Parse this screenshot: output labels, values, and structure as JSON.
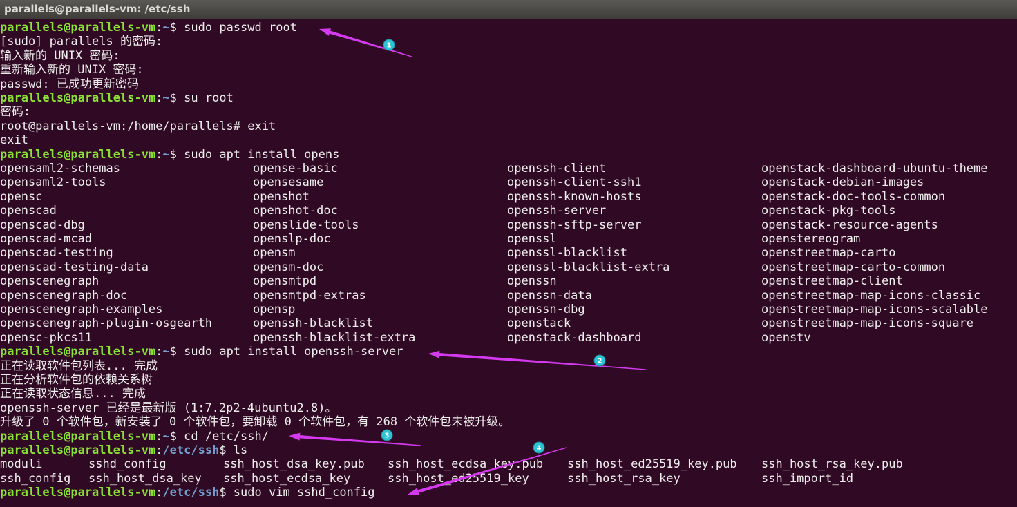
{
  "window": {
    "title": "parallels@parallels-vm: /etc/ssh"
  },
  "prompt": {
    "user": "parallels@parallels-vm",
    "colon": ":",
    "dollar": "$ "
  },
  "lines": [
    {
      "type": "prompt",
      "path": "~",
      "cmd": "sudo passwd root"
    },
    {
      "type": "text",
      "text": "[sudo] parallels 的密码:"
    },
    {
      "type": "text",
      "text": "输入新的 UNIX 密码:"
    },
    {
      "type": "text",
      "text": "重新输入新的 UNIX 密码:"
    },
    {
      "type": "text",
      "text": "passwd: 已成功更新密码"
    },
    {
      "type": "prompt",
      "path": "~",
      "cmd": "su root"
    },
    {
      "type": "text",
      "text": "密码:"
    },
    {
      "type": "text",
      "text": "root@parallels-vm:/home/parallels# exit"
    },
    {
      "type": "text",
      "text": "exit"
    },
    {
      "type": "prompt",
      "path": "~",
      "cmd": "sudo apt install opens"
    },
    {
      "type": "grid",
      "cells": [
        "opensaml2-schemas",
        "opense-basic",
        "openssh-client",
        "openstack-dashboard-ubuntu-theme"
      ]
    },
    {
      "type": "grid",
      "cells": [
        "opensaml2-tools",
        "opensesame",
        "openssh-client-ssh1",
        "openstack-debian-images"
      ]
    },
    {
      "type": "grid",
      "cells": [
        "opensc",
        "openshot",
        "openssh-known-hosts",
        "openstack-doc-tools-common"
      ]
    },
    {
      "type": "grid",
      "cells": [
        "openscad",
        "openshot-doc",
        "openssh-server",
        "openstack-pkg-tools"
      ]
    },
    {
      "type": "grid",
      "cells": [
        "openscad-dbg",
        "openslide-tools",
        "openssh-sftp-server",
        "openstack-resource-agents"
      ]
    },
    {
      "type": "grid",
      "cells": [
        "openscad-mcad",
        "openslp-doc",
        "openssl",
        "openstereogram"
      ]
    },
    {
      "type": "grid",
      "cells": [
        "openscad-testing",
        "opensm",
        "openssl-blacklist",
        "openstreetmap-carto"
      ]
    },
    {
      "type": "grid",
      "cells": [
        "openscad-testing-data",
        "opensm-doc",
        "openssl-blacklist-extra",
        "openstreetmap-carto-common"
      ]
    },
    {
      "type": "grid",
      "cells": [
        "openscenegraph",
        "opensmtpd",
        "openssn",
        "openstreetmap-client"
      ]
    },
    {
      "type": "grid",
      "cells": [
        "openscenegraph-doc",
        "opensmtpd-extras",
        "openssn-data",
        "openstreetmap-map-icons-classic"
      ]
    },
    {
      "type": "grid",
      "cells": [
        "openscenegraph-examples",
        "opensp",
        "openssn-dbg",
        "openstreetmap-map-icons-scalable"
      ]
    },
    {
      "type": "grid",
      "cells": [
        "openscenegraph-plugin-osgearth",
        "openssh-blacklist",
        "openstack",
        "openstreetmap-map-icons-square"
      ]
    },
    {
      "type": "grid",
      "cells": [
        "opensc-pkcs11",
        "openssh-blacklist-extra",
        "openstack-dashboard",
        "openstv"
      ]
    },
    {
      "type": "prompt",
      "path": "~",
      "cmd": "sudo apt install openssh-server"
    },
    {
      "type": "text",
      "text": "正在读取软件包列表... 完成"
    },
    {
      "type": "text",
      "text": "正在分析软件包的依赖关系树"
    },
    {
      "type": "text",
      "text": "正在读取状态信息... 完成"
    },
    {
      "type": "text",
      "text": "openssh-server 已经是最新版 (1:7.2p2-4ubuntu2.8)。"
    },
    {
      "type": "text",
      "text": "升级了 0 个软件包，新安装了 0 个软件包，要卸载 0 个软件包，有 268 个软件包未被升级。"
    },
    {
      "type": "prompt",
      "path": "~",
      "cmd": "cd /etc/ssh/"
    },
    {
      "type": "prompt",
      "path": "/etc/ssh",
      "cmd": "ls"
    },
    {
      "type": "ls",
      "cells": [
        "moduli",
        "sshd_config",
        "ssh_host_dsa_key.pub",
        "ssh_host_ecdsa_key.pub",
        "ssh_host_ed25519_key.pub",
        "ssh_host_rsa_key.pub"
      ]
    },
    {
      "type": "ls",
      "cells": [
        "ssh_config",
        "ssh_host_dsa_key",
        "ssh_host_ecdsa_key",
        "ssh_host_ed25519_key",
        "ssh_host_rsa_key",
        "ssh_import_id"
      ]
    },
    {
      "type": "prompt",
      "path": "/etc/ssh",
      "cmd": "sudo vim sshd_config"
    }
  ],
  "annotations": {
    "color": "#d63af0",
    "badge_color": "#2ec4d6",
    "badges": [
      "1",
      "2",
      "3",
      "4"
    ]
  },
  "colors": {
    "background": "#300a24",
    "prompt_user": "#8ae234",
    "prompt_path": "#729fcf",
    "text": "#eeeeec"
  }
}
